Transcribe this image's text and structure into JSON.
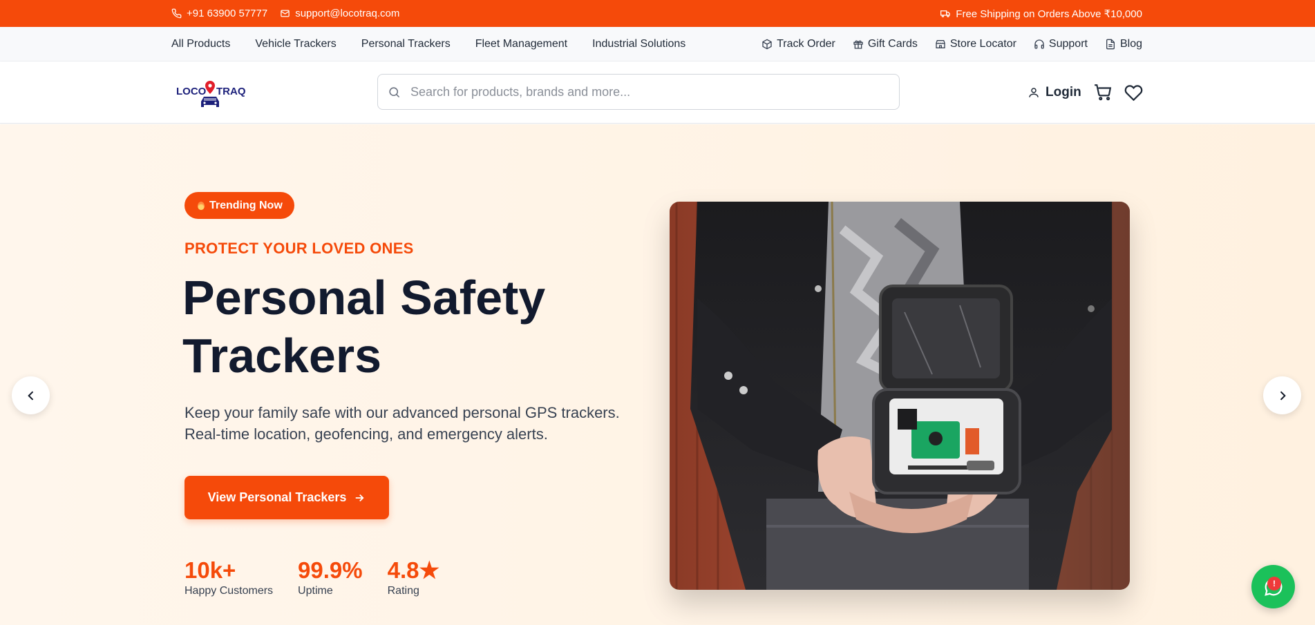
{
  "topbar": {
    "phone": "+91 63900 57777",
    "email": "support@locotraq.com",
    "shipping": "Free Shipping on Orders Above ₹10,000"
  },
  "nav": {
    "categories": [
      {
        "label": "All Products"
      },
      {
        "label": "Vehicle Trackers"
      },
      {
        "label": "Personal Trackers"
      },
      {
        "label": "Fleet Management"
      },
      {
        "label": "Industrial Solutions"
      }
    ],
    "utilities": {
      "track_order": "Track Order",
      "gift_cards": "Gift Cards",
      "store_locator": "Store Locator",
      "support": "Support",
      "blog": "Blog"
    }
  },
  "header": {
    "logo": {
      "left": "LOCO",
      "right": "TRAQ"
    },
    "search_placeholder": "Search for products, brands and more...",
    "login_label": "Login"
  },
  "hero": {
    "badge": "Trending Now",
    "eyebrow": "PROTECT YOUR LOVED ONES",
    "headline": "Personal Safety Trackers",
    "description": "Keep your family safe with our advanced personal GPS trackers. Real-time location, geofencing, and emergency alerts.",
    "cta_label": "View Personal Trackers",
    "stats": [
      {
        "value": "10k+",
        "label": "Happy Customers"
      },
      {
        "value": "99.9%",
        "label": "Uptime"
      },
      {
        "value": "4.8★",
        "label": "Rating"
      }
    ]
  },
  "whatsapp_badge": "!",
  "colors": {
    "brand": "#f54a0a",
    "headline": "#121a2e",
    "whatsapp": "#1bc15a",
    "hero_bg": "#fff4e6"
  }
}
